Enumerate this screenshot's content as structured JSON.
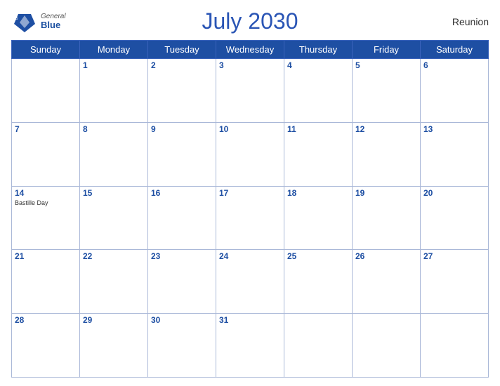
{
  "header": {
    "title": "July 2030",
    "region": "Reunion",
    "logo": {
      "general": "General",
      "blue": "Blue"
    }
  },
  "weekdays": [
    "Sunday",
    "Monday",
    "Tuesday",
    "Wednesday",
    "Thursday",
    "Friday",
    "Saturday"
  ],
  "weeks": [
    [
      {
        "date": "",
        "event": ""
      },
      {
        "date": "1",
        "event": ""
      },
      {
        "date": "2",
        "event": ""
      },
      {
        "date": "3",
        "event": ""
      },
      {
        "date": "4",
        "event": ""
      },
      {
        "date": "5",
        "event": ""
      },
      {
        "date": "6",
        "event": ""
      }
    ],
    [
      {
        "date": "7",
        "event": ""
      },
      {
        "date": "8",
        "event": ""
      },
      {
        "date": "9",
        "event": ""
      },
      {
        "date": "10",
        "event": ""
      },
      {
        "date": "11",
        "event": ""
      },
      {
        "date": "12",
        "event": ""
      },
      {
        "date": "13",
        "event": ""
      }
    ],
    [
      {
        "date": "14",
        "event": "Bastille Day"
      },
      {
        "date": "15",
        "event": ""
      },
      {
        "date": "16",
        "event": ""
      },
      {
        "date": "17",
        "event": ""
      },
      {
        "date": "18",
        "event": ""
      },
      {
        "date": "19",
        "event": ""
      },
      {
        "date": "20",
        "event": ""
      }
    ],
    [
      {
        "date": "21",
        "event": ""
      },
      {
        "date": "22",
        "event": ""
      },
      {
        "date": "23",
        "event": ""
      },
      {
        "date": "24",
        "event": ""
      },
      {
        "date": "25",
        "event": ""
      },
      {
        "date": "26",
        "event": ""
      },
      {
        "date": "27",
        "event": ""
      }
    ],
    [
      {
        "date": "28",
        "event": ""
      },
      {
        "date": "29",
        "event": ""
      },
      {
        "date": "30",
        "event": ""
      },
      {
        "date": "31",
        "event": ""
      },
      {
        "date": "",
        "event": ""
      },
      {
        "date": "",
        "event": ""
      },
      {
        "date": "",
        "event": ""
      }
    ]
  ]
}
